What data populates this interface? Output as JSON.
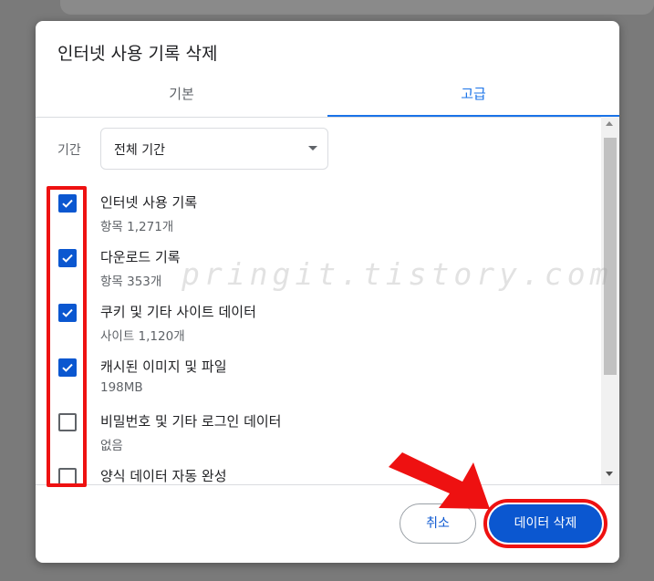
{
  "dialog": {
    "title": "인터넷 사용 기록 삭제",
    "tabs": [
      {
        "label": "기본",
        "active": false
      },
      {
        "label": "고급",
        "active": true
      }
    ],
    "period": {
      "label": "기간",
      "value": "전체 기간"
    },
    "items": [
      {
        "title": "인터넷 사용 기록",
        "sub": "항목 1,271개",
        "checked": true
      },
      {
        "title": "다운로드 기록",
        "sub": "항목 353개",
        "checked": true
      },
      {
        "title": "쿠키 및 기타 사이트 데이터",
        "sub": "사이트 1,120개",
        "checked": true
      },
      {
        "title": "캐시된 이미지 및 파일",
        "sub": "198MB",
        "checked": true
      },
      {
        "title": "비밀번호 및 기타 로그인 데이터",
        "sub": "없음",
        "checked": false
      },
      {
        "title": "양식 데이터 자동 완성",
        "sub": "",
        "checked": false
      }
    ],
    "buttons": {
      "cancel": "취소",
      "delete": "데이터 삭제"
    }
  },
  "watermark": "pringit.tistory.com",
  "colors": {
    "accent": "#0b57d0",
    "tab_accent": "#1a73e8",
    "annotation": "#ee1111"
  },
  "icons": [
    "check-icon",
    "dropdown-arrow-icon",
    "scroll-up-icon",
    "scroll-down-icon",
    "annotation-arrow"
  ]
}
